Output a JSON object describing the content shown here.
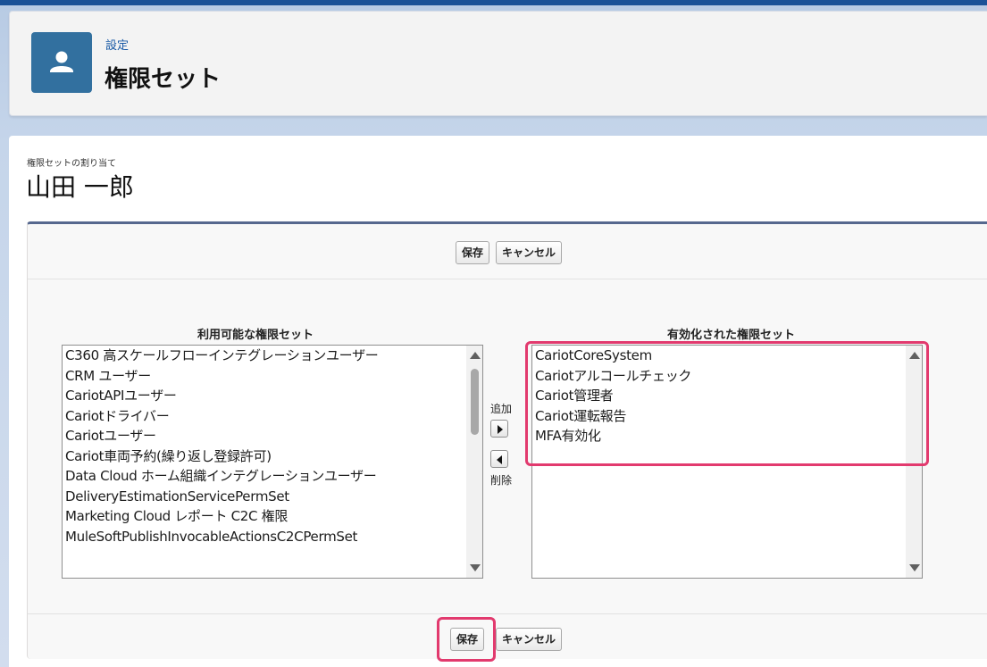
{
  "header": {
    "label": "設定",
    "title": "権限セット",
    "icon": "user-icon"
  },
  "assignment": {
    "label": "権限セットの割り当て",
    "user_name": "山田 一郎"
  },
  "buttons": {
    "save": "保存",
    "cancel": "キャンセル"
  },
  "available": {
    "heading": "利用可能な権限セット",
    "items": [
      "C360 高スケールフローインテグレーションユーザー",
      "CRM ユーザー",
      "CariotAPIユーザー",
      "Cariotドライバー",
      "Cariotユーザー",
      "Cariot車両予約(繰り返し登録許可)",
      "Data Cloud ホーム組織インテグレーションユーザー",
      "DeliveryEstimationServicePermSet",
      "Marketing Cloud レポート C2C 権限",
      "MuleSoftPublishInvocableActionsC2CPermSet"
    ]
  },
  "enabled": {
    "heading": "有効化された権限セット",
    "items": [
      "CariotCoreSystem",
      "Cariotアルコールチェック",
      "Cariot管理者",
      "Cariot運転報告",
      "MFA有効化"
    ]
  },
  "move": {
    "add_label": "追加",
    "remove_label": "削除"
  },
  "colors": {
    "header_icon_bg": "#32709f",
    "highlight": "#e23a6e",
    "link_blue": "#1a5aa6"
  }
}
